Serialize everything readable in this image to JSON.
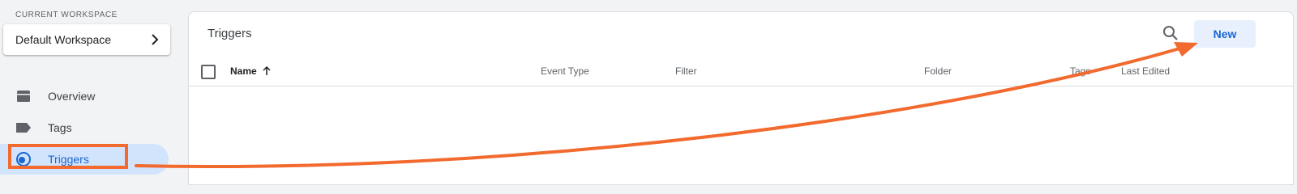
{
  "sidebar": {
    "workspace_label": "CURRENT WORKSPACE",
    "workspace_name": "Default Workspace",
    "items": [
      {
        "label": "Overview",
        "icon": "folder-icon"
      },
      {
        "label": "Tags",
        "icon": "tag-icon"
      },
      {
        "label": "Triggers",
        "icon": "trigger-icon",
        "active": true
      }
    ]
  },
  "main": {
    "title": "Triggers",
    "new_label": "New",
    "columns": [
      "Name",
      "Event Type",
      "Filter",
      "Folder",
      "Tags",
      "Last Edited"
    ]
  },
  "colors": {
    "accent": "#1967d2",
    "active_bg": "#d2e3fc",
    "annotation": "#f26a2e"
  }
}
